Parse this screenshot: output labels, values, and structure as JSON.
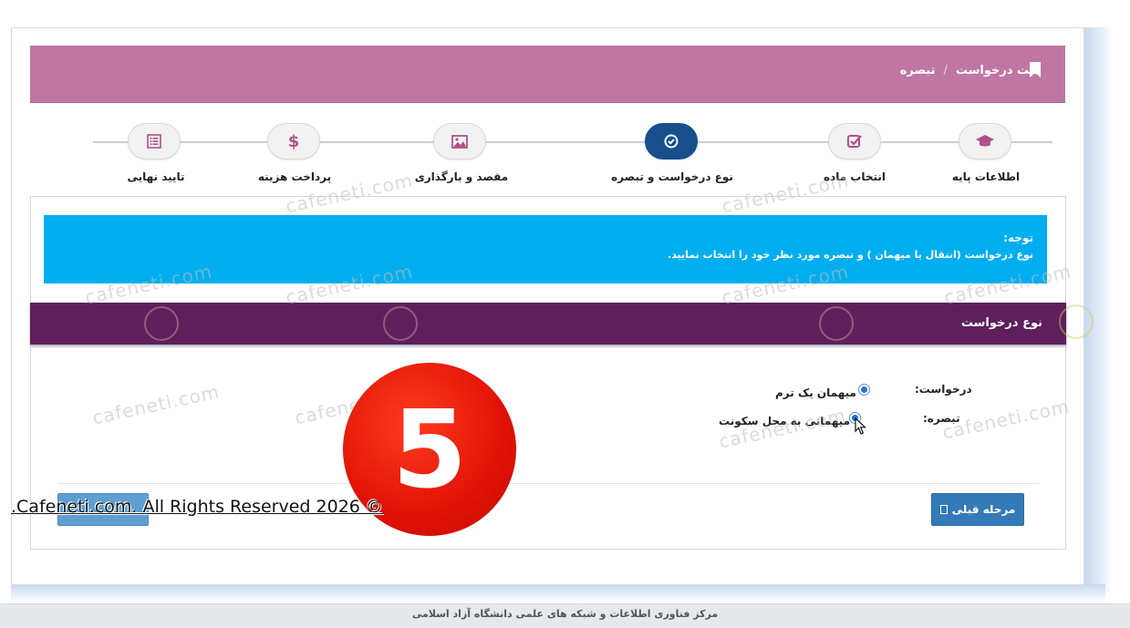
{
  "header": {
    "title": "ثبت درخواست",
    "separator": "/",
    "current": "تبصره"
  },
  "steps": [
    {
      "label": "اطلاعات پایه",
      "icon": "graduation-cap-icon",
      "active": false
    },
    {
      "label": "انتخاب ماده",
      "icon": "check-square-icon",
      "active": false
    },
    {
      "label": "نوع درخواست و تبصره",
      "icon": "check-circle-icon",
      "active": true
    },
    {
      "label": "مقصد و بارگذاری",
      "icon": "image-icon",
      "active": false
    },
    {
      "label": "پرداخت هزینه",
      "icon": "dollar-icon",
      "active": false
    },
    {
      "label": "تایید نهایی",
      "icon": "list-icon",
      "active": false
    }
  ],
  "notice": {
    "title": "توجه:",
    "text": "نوع درخواست (انتقال یا میهمان ) و تبصره مورد نظر خود را انتخاب نمایید."
  },
  "section": {
    "title": "نوع درخواست"
  },
  "form": {
    "request_label": "درخواست:",
    "request_option": "میهمان یک ترم",
    "note_label": "تبصره:",
    "note_option": "میهمانی به محل سکونت"
  },
  "buttons": {
    "prev": "مرحله قبلی"
  },
  "footer": {
    "text": "مرکز فناوری اطلاعات و شبکه های علمی دانشگاه آزاد اسلامی"
  },
  "overlay": {
    "watermark": "cafeneti.com",
    "badge": "5",
    "copyright": ".Cafeneti.com. All Rights Reserved 2026 ©"
  },
  "colors": {
    "header": "#bf76a3",
    "active_step": "#174f8d",
    "notice": "#00aeef",
    "section": "#5e1f5c",
    "button": "#337ab7"
  }
}
